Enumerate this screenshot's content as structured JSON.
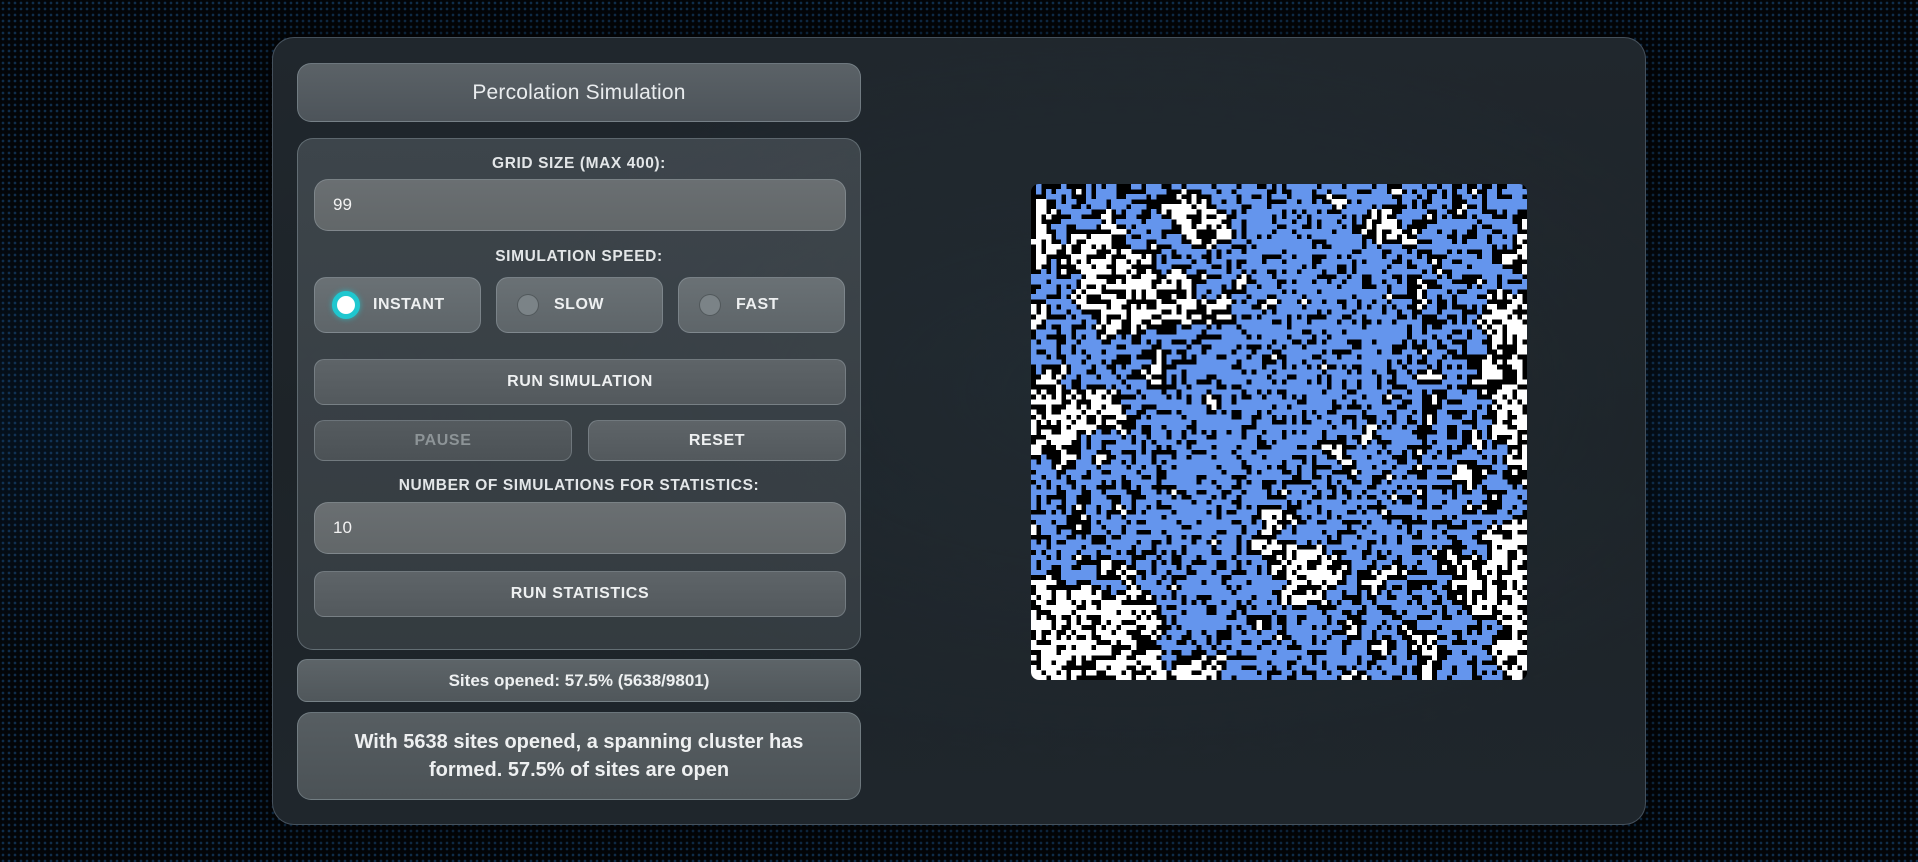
{
  "app": {
    "title": "Percolation Simulation"
  },
  "controls": {
    "grid_size_label": "GRID SIZE (MAX 400):",
    "grid_size_value": "99",
    "speed_label": "SIMULATION SPEED:",
    "speed_options": [
      {
        "label": "INSTANT",
        "selected": true
      },
      {
        "label": "SLOW",
        "selected": false
      },
      {
        "label": "FAST",
        "selected": false
      }
    ],
    "run_simulation_label": "RUN SIMULATION",
    "pause_label": "PAUSE",
    "pause_disabled": true,
    "reset_label": "RESET",
    "num_sims_label": "NUMBER OF SIMULATIONS FOR STATISTICS:",
    "num_sims_value": "10",
    "run_statistics_label": "RUN STATISTICS"
  },
  "status": {
    "sites_opened": "Sites opened: 57.5% (5638/9801)",
    "message": "With 5638 sites opened, a spanning cluster has formed. 57.5% of sites are open"
  },
  "grid": {
    "size": 99,
    "open_fraction": 0.575,
    "colors": {
      "blocked": "#000000",
      "open": "#ffffff",
      "full": "#6495ed",
      "accent": "#1fc7cf"
    }
  }
}
